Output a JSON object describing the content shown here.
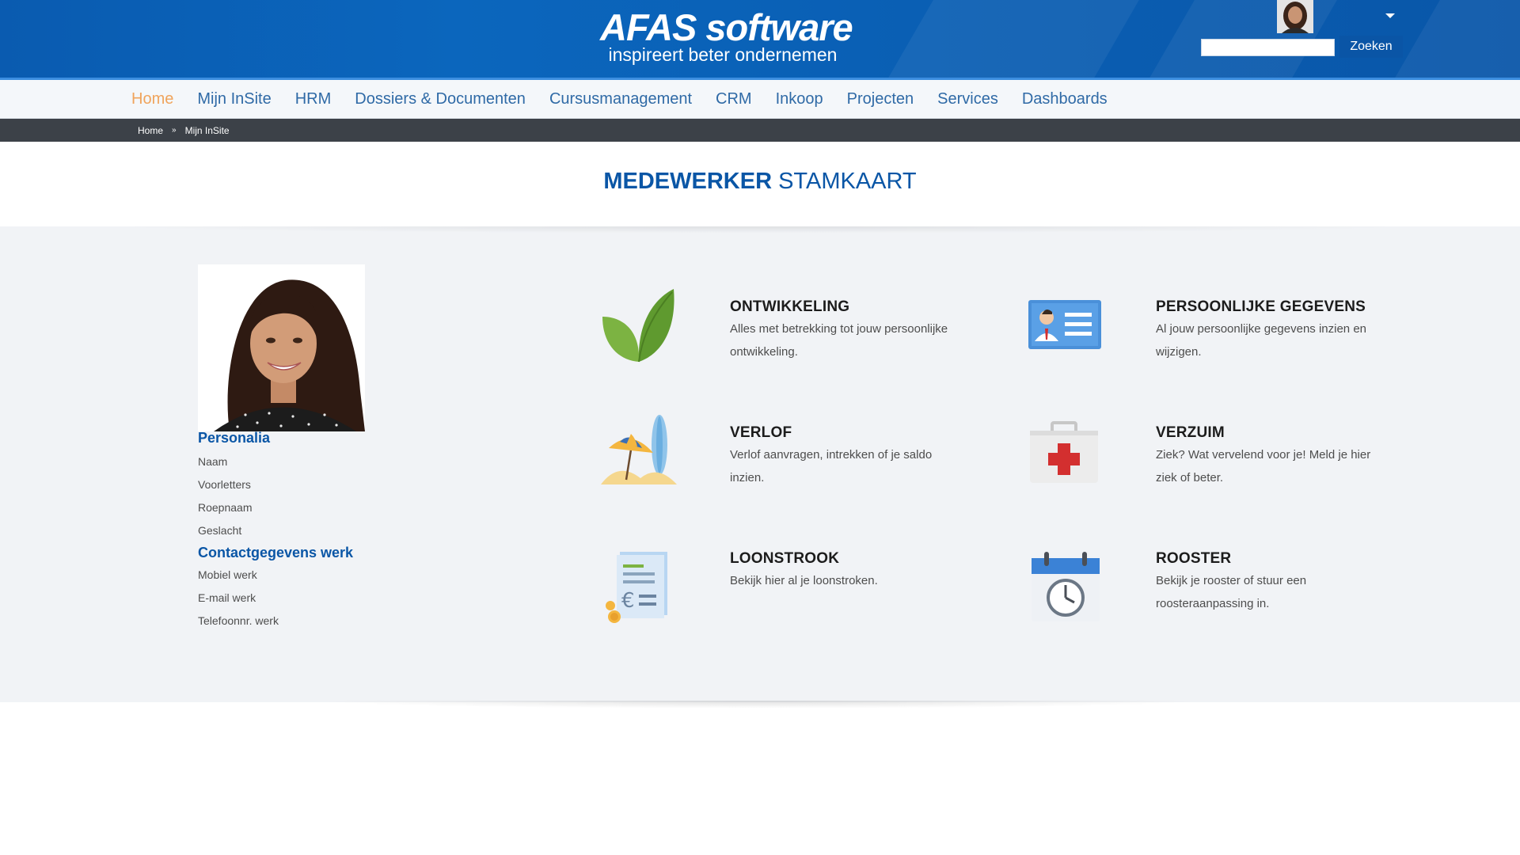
{
  "header": {
    "logo_main": "AFAS software",
    "logo_sub": "inspireert beter ondernemen",
    "search_placeholder": "",
    "search_button": "Zoeken"
  },
  "nav": {
    "items": [
      {
        "label": "Home",
        "active": true
      },
      {
        "label": "Mijn InSite"
      },
      {
        "label": "HRM"
      },
      {
        "label": "Dossiers & Documenten"
      },
      {
        "label": "Cursusmanagement"
      },
      {
        "label": "CRM"
      },
      {
        "label": "Inkoop"
      },
      {
        "label": "Projecten"
      },
      {
        "label": "Services"
      },
      {
        "label": "Dashboards"
      }
    ]
  },
  "breadcrumb": {
    "items": [
      "Home",
      "Mijn InSite"
    ],
    "separator": "»"
  },
  "page": {
    "title_bold": "MEDEWERKER",
    "title_rest": "STAMKAART"
  },
  "profile": {
    "personalia_heading": "Personalia",
    "personalia_fields": [
      "Naam",
      "Voorletters",
      "Roepnaam",
      "Geslacht"
    ],
    "contact_heading": "Contactgegevens werk",
    "contact_fields": [
      "Mobiel werk",
      "E-mail werk",
      "Telefoonnr. werk"
    ]
  },
  "tiles": [
    {
      "icon": "leaf-icon",
      "title": "ONTWIKKELING",
      "desc": "Alles met betrekking tot jouw persoonlijke ontwikkeling."
    },
    {
      "icon": "id-card-icon",
      "title": "PERSOONLIJKE GEGEVENS",
      "desc": "Al jouw persoonlijke gegevens inzien en wijzigen."
    },
    {
      "icon": "beach-umbrella-icon",
      "title": "VERLOF",
      "desc": "Verlof aanvragen, intrekken of je saldo inzien."
    },
    {
      "icon": "first-aid-kit-icon",
      "title": "VERZUIM",
      "desc": "Ziek? Wat vervelend voor je! Meld je hier ziek of beter."
    },
    {
      "icon": "payslip-euro-icon",
      "title": "LOONSTROOK",
      "desc": "Bekijk hier al je loonstroken."
    },
    {
      "icon": "calendar-clock-icon",
      "title": "ROOSTER",
      "desc": "Bekijk je rooster of stuur een roosteraanpassing in."
    }
  ],
  "colors": {
    "brand_blue": "#0a5bb0",
    "nav_link": "#2f6aa6",
    "nav_active": "#f0a45c",
    "breadcrumb_bar": "#3c4148",
    "band_bg": "#f1f3f6"
  }
}
